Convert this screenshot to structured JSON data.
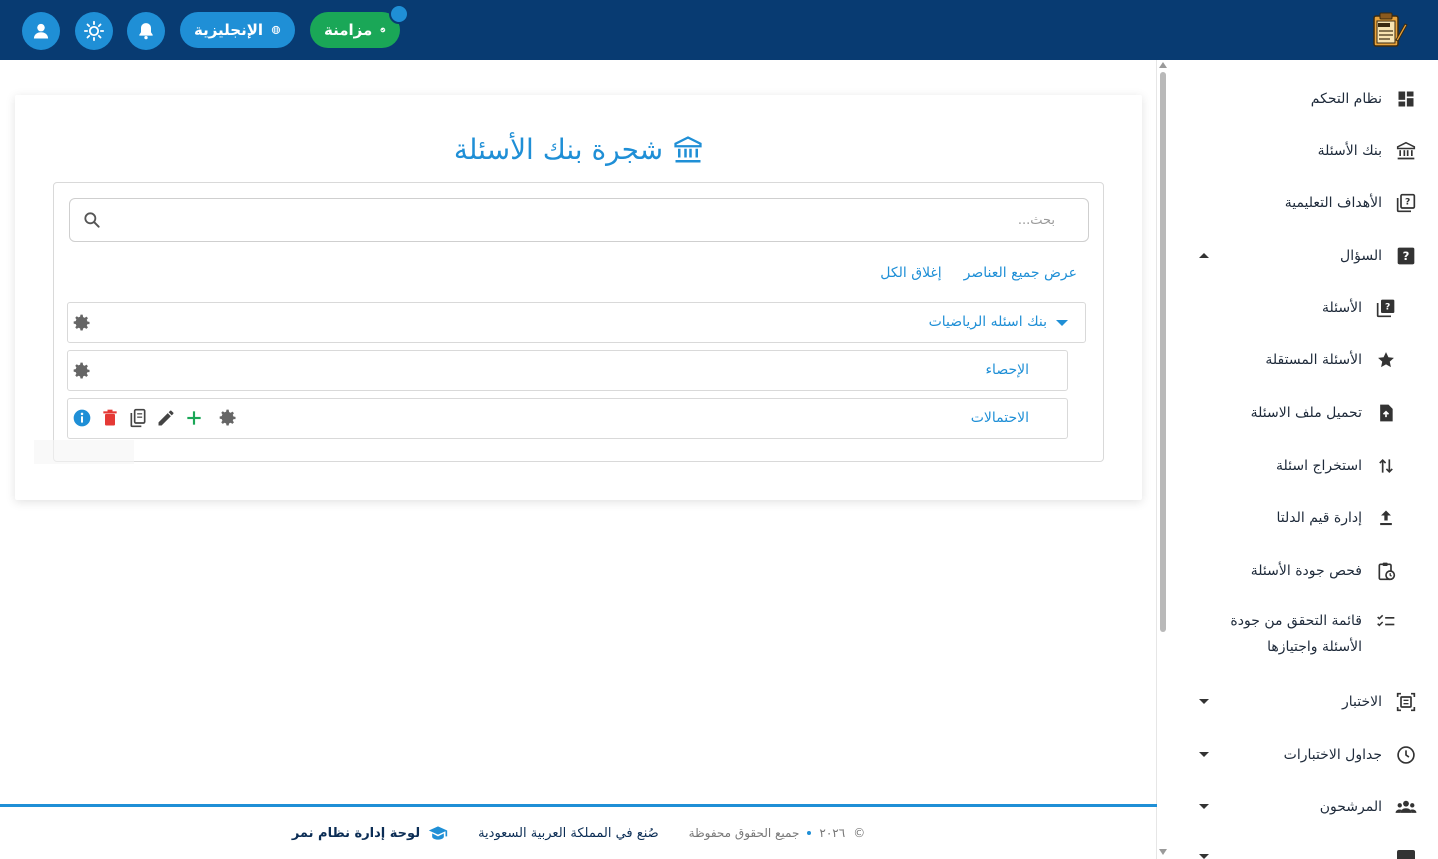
{
  "header": {
    "language_label": "الإنجليزية",
    "sync_label": "مزامنة",
    "user_icon": "user-icon",
    "theme_icon": "sun-icon",
    "notifications_icon": "bell-icon",
    "logo_icon": "exam-logo-icon"
  },
  "sidebar": {
    "items": [
      {
        "label": "نظام التحكم",
        "icon": "dashboard-icon"
      },
      {
        "label": "بنك الأسئلة",
        "icon": "bank-icon"
      },
      {
        "label": "الأهداف التعليمية",
        "icon": "book-question-icon"
      },
      {
        "label": "السؤال",
        "icon": "question-icon",
        "expanded": true
      },
      {
        "label": "الأسئلة",
        "icon": "questions-library-icon"
      },
      {
        "label": "الأسئلة المستقلة",
        "icon": "star-icon"
      },
      {
        "label": "تحميل ملف الاسئلة",
        "icon": "file-upload-icon"
      },
      {
        "label": "استخراج اسئلة",
        "icon": "swap-vertical-icon"
      },
      {
        "label": "إدارة قيم الدلتا",
        "icon": "upload-icon"
      },
      {
        "label": "فحص جودة الأسئلة",
        "icon": "clipboard-clock-icon"
      },
      {
        "label_line1": "قائمة التحقق من جودة",
        "label_line2": "الأسئلة واجتيازها",
        "icon": "checklist-icon"
      },
      {
        "label": "الاختبار",
        "icon": "exam-frame-icon"
      },
      {
        "label": "جداول الاختبارات",
        "icon": "clock-icon"
      },
      {
        "label": "المرشحون",
        "icon": "people-icon"
      }
    ]
  },
  "main": {
    "title": "شجرة بنك الأسئلة",
    "search": {
      "placeholder": "بحث...",
      "value": ""
    },
    "show_all_label": "عرض جميع العناصر",
    "close_all_label": "إغلاق الكل",
    "tree": [
      {
        "label": "بنك اسئله الرياضيات",
        "expanded": true
      },
      {
        "label": "الإحصاء"
      },
      {
        "label": "الاحتمالات",
        "selected": true
      }
    ]
  },
  "footer": {
    "brand": "لوحة إدارة نظام نمر",
    "made_in": "صُنع في المملكة العربية السعودية",
    "copyright_symbol": "©",
    "year": "٢٠٢٦",
    "rights": "جميع الحقوق محفوظة"
  },
  "colors": {
    "header_bg": "#083b72",
    "accent": "#1f8fd6",
    "success": "#1aa757",
    "danger": "#e53935"
  }
}
